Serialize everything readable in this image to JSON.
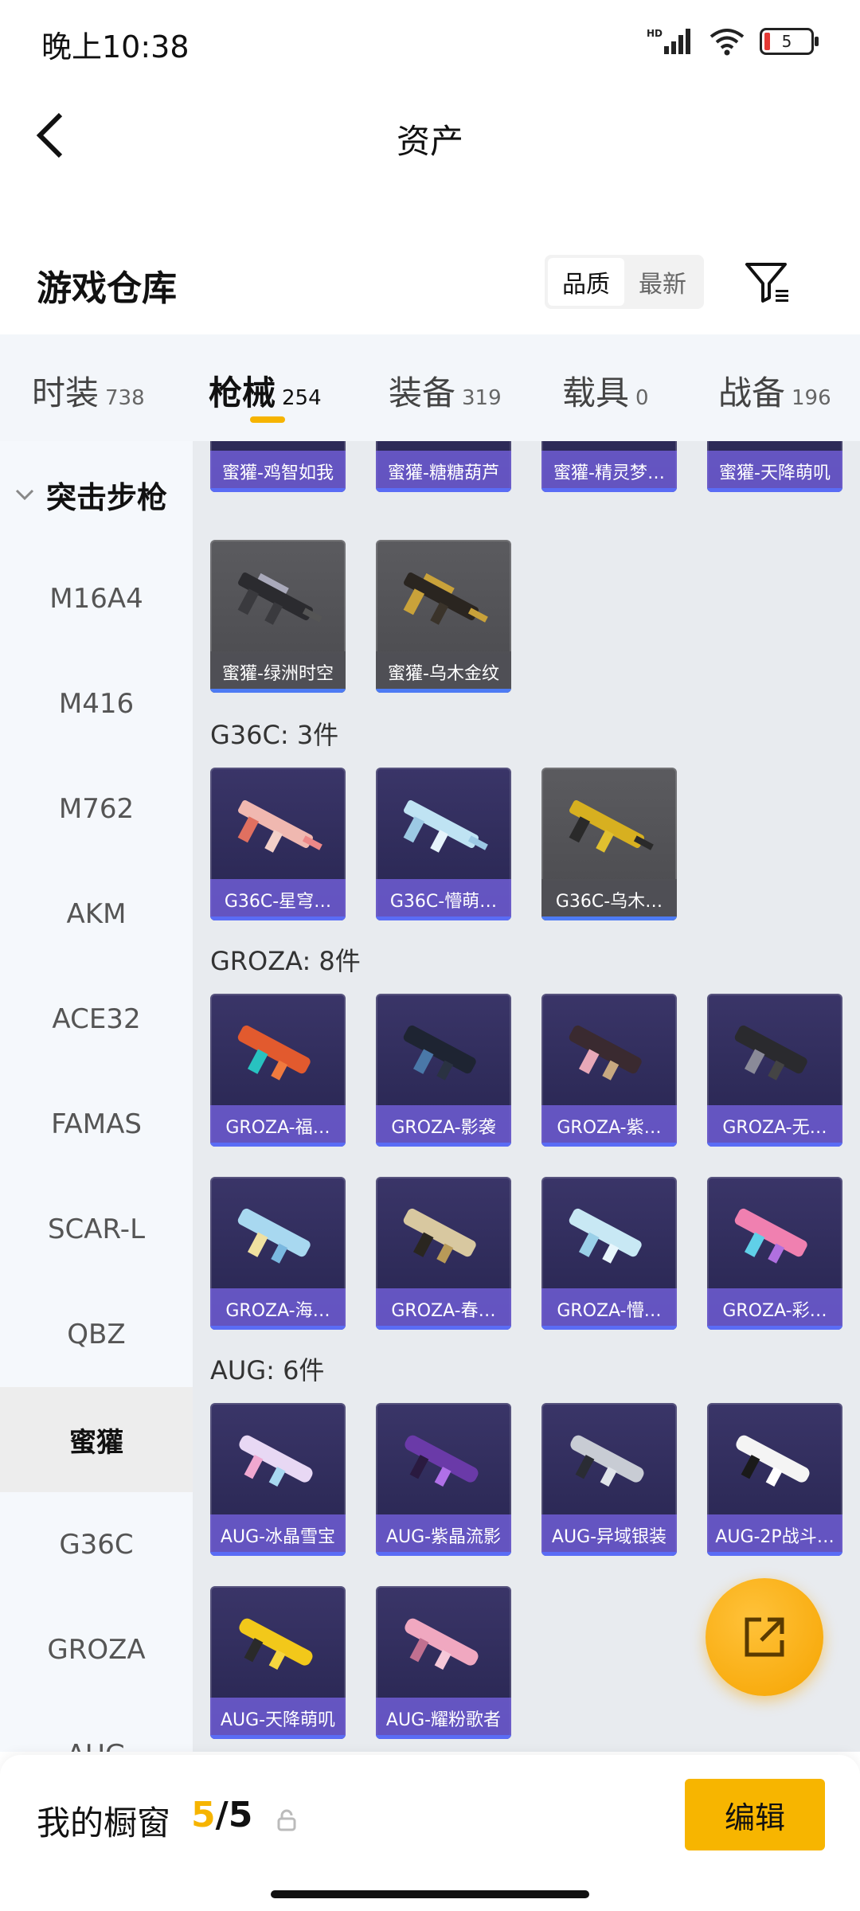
{
  "status": {
    "time": "晚上10:38",
    "battery": "5",
    "hd": "HD"
  },
  "header": {
    "title": "资产"
  },
  "section": {
    "title": "游戏仓库",
    "sort_options": [
      "品质",
      "最新"
    ]
  },
  "tabs": [
    {
      "label": "时装",
      "count": "738"
    },
    {
      "label": "枪械",
      "count": "254"
    },
    {
      "label": "装备",
      "count": "319"
    },
    {
      "label": "载具",
      "count": "0"
    },
    {
      "label": "战备",
      "count": "196"
    }
  ],
  "sidebar": {
    "category": "突击步枪",
    "items": [
      "M16A4",
      "M416",
      "M762",
      "AKM",
      "ACE32",
      "FAMAS",
      "SCAR-L",
      "QBZ",
      "蜜獾",
      "G36C",
      "GROZA",
      "AUG"
    ]
  },
  "content": {
    "partial_row": [
      "蜜獾-鸡智如我",
      "蜜獾-糖糖葫芦",
      "蜜獾-精灵梦…",
      "蜜獾-天降萌叽"
    ],
    "mihuang_row2": [
      "蜜獾-绿洲时空",
      "蜜獾-乌木金纹"
    ],
    "g36c": {
      "label": "G36C: 3件",
      "items": [
        "G36C-星穹…",
        "G36C-懵萌…",
        "G36C-乌木…"
      ]
    },
    "groza": {
      "label": "GROZA: 8件",
      "items": [
        "GROZA-福…",
        "GROZA-影袭",
        "GROZA-紫…",
        "GROZA-无…",
        "GROZA-海…",
        "GROZA-春…",
        "GROZA-懵…",
        "GROZA-彩…"
      ]
    },
    "aug": {
      "label": "AUG: 6件",
      "items": [
        "AUG-冰晶雪宝",
        "AUG-紫晶流影",
        "AUG-异域银装",
        "AUG-2P战斗…",
        "AUG-天降萌叽",
        "AUG-耀粉歌者"
      ]
    }
  },
  "showcase": {
    "label": "我的橱窗",
    "current": "5",
    "total": "/5",
    "edit_label": "编辑"
  }
}
